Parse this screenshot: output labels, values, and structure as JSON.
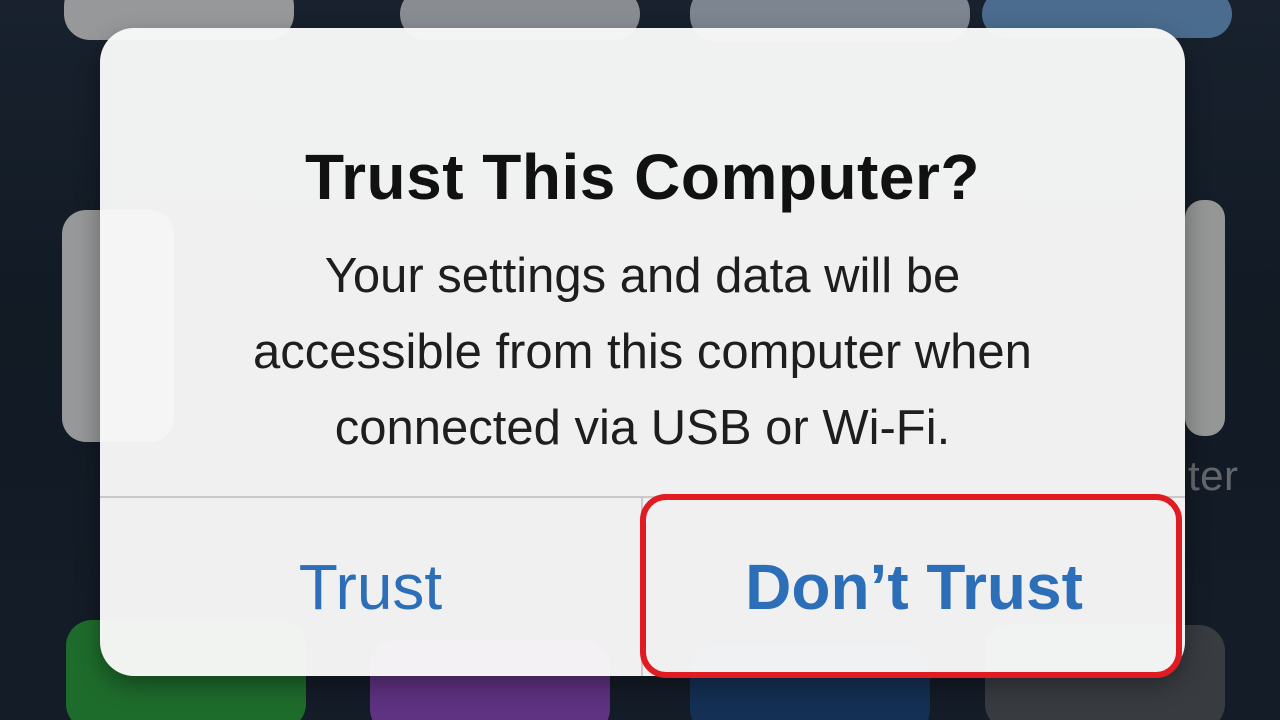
{
  "background": {
    "partial_label_right": "ter"
  },
  "alert": {
    "title": "Trust This Computer?",
    "message": "Your settings and data will be\naccessible from this computer when\nconnected via USB or Wi-Fi.",
    "buttons": {
      "trust": "Trust",
      "dont_trust": "Don’t Trust"
    }
  },
  "colors": {
    "button_blue": "#2d6eb8",
    "highlight_red": "#e11b22"
  }
}
